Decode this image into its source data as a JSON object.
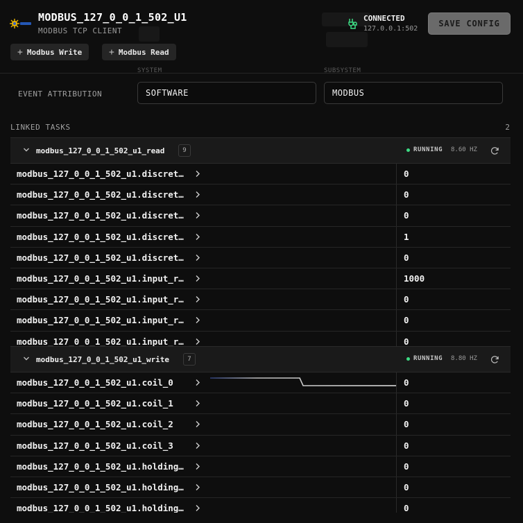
{
  "header": {
    "title": "MODBUS_127_0_0_1_502_U1",
    "subtitle": "MODBUS TCP CLIENT",
    "buttons": [
      {
        "label": "Modbus Write"
      },
      {
        "label": "Modbus Read"
      }
    ],
    "connection": {
      "status": "CONNECTED",
      "address": "127.0.0.1:502"
    },
    "save_label": "SAVE CONFIG"
  },
  "attribution": {
    "label": "EVENT ATTRIBUTION",
    "system_caption": "SYSTEM",
    "subsystem_caption": "SUBSYSTEM",
    "system_value": "SOFTWARE",
    "subsystem_value": "MODBUS"
  },
  "linked_tasks": {
    "label": "LINKED TASKS",
    "count": "2",
    "tasks": [
      {
        "name": "modbus_127_0_0_1_502_u1_read",
        "badge": "9",
        "status": "RUNNING",
        "rate": "8.60 HZ",
        "channels": [
          {
            "name": "modbus_127_0_0_1_502_u1.discrete_input_0",
            "value": "0",
            "trace": [
              0,
              0,
              0,
              0,
              0,
              0,
              0,
              0,
              0,
              0
            ]
          },
          {
            "name": "modbus_127_0_0_1_502_u1.discrete_input_1",
            "value": "0",
            "trace": [
              0,
              0,
              0,
              0,
              0,
              0,
              0,
              0,
              0,
              0
            ]
          },
          {
            "name": "modbus_127_0_0_1_502_u1.discrete_input_2",
            "value": "0",
            "trace": [
              0,
              0,
              0,
              0,
              0,
              0,
              0,
              0,
              0,
              0
            ]
          },
          {
            "name": "modbus_127_0_0_1_502_u1.discrete_input_3",
            "value": "1",
            "trace": [
              1,
              1,
              1,
              1,
              1,
              1,
              1,
              1,
              1,
              1
            ]
          },
          {
            "name": "modbus_127_0_0_1_502_u1.discrete_input_4",
            "value": "0",
            "trace": [
              0,
              0,
              0,
              0,
              0,
              0,
              0,
              0,
              0,
              0
            ]
          },
          {
            "name": "modbus_127_0_0_1_502_u1.input_register_0",
            "value": "1000",
            "trace": [
              1,
              1,
              1,
              1,
              1,
              1,
              1,
              1,
              1,
              1
            ]
          },
          {
            "name": "modbus_127_0_0_1_502_u1.input_register_1",
            "value": "0",
            "trace": [
              0,
              0,
              0,
              0,
              0,
              0,
              0,
              0,
              0,
              0
            ]
          },
          {
            "name": "modbus_127_0_0_1_502_u1.input_register_2",
            "value": "0",
            "trace": [
              0,
              0,
              0,
              0,
              0,
              0,
              0,
              0,
              0,
              0
            ]
          },
          {
            "name": "modbus_127_0_0_1_502_u1.input_register_3",
            "value": "0",
            "trace": [
              0,
              0,
              0,
              0,
              0,
              0,
              0,
              0,
              0,
              0
            ]
          }
        ]
      },
      {
        "name": "modbus_127_0_0_1_502_u1_write",
        "badge": "7",
        "status": "RUNNING",
        "rate": "8.80 HZ",
        "channels": [
          {
            "name": "modbus_127_0_0_1_502_u1.coil_0",
            "value": "0",
            "trace": [
              1,
              1,
              1,
              1,
              1,
              1,
              0,
              0,
              0,
              0,
              0,
              0
            ]
          },
          {
            "name": "modbus_127_0_0_1_502_u1.coil_1",
            "value": "0",
            "trace": [
              0,
              0,
              0,
              0,
              0,
              0,
              0,
              0,
              0,
              0
            ]
          },
          {
            "name": "modbus_127_0_0_1_502_u1.coil_2",
            "value": "0",
            "trace": [
              0,
              0,
              0,
              0,
              0,
              0,
              0,
              0,
              0,
              0
            ]
          },
          {
            "name": "modbus_127_0_0_1_502_u1.coil_3",
            "value": "0",
            "trace": [
              0,
              0,
              0,
              0,
              0,
              0,
              0,
              0,
              0,
              0
            ]
          },
          {
            "name": "modbus_127_0_0_1_502_u1.holding_register_0",
            "value": "0",
            "trace": [
              0,
              0,
              0,
              0,
              0,
              0,
              0,
              0,
              0,
              0
            ]
          },
          {
            "name": "modbus_127_0_0_1_502_u1.holding_register_1",
            "value": "0",
            "trace": [
              0,
              0,
              0,
              0,
              0,
              0,
              0,
              0,
              0,
              0
            ]
          },
          {
            "name": "modbus_127_0_0_1_502_u1.holding_register_2",
            "value": "0",
            "trace": [
              0,
              0,
              0,
              0,
              0,
              0,
              0,
              0,
              0,
              0
            ]
          }
        ]
      }
    ]
  }
}
